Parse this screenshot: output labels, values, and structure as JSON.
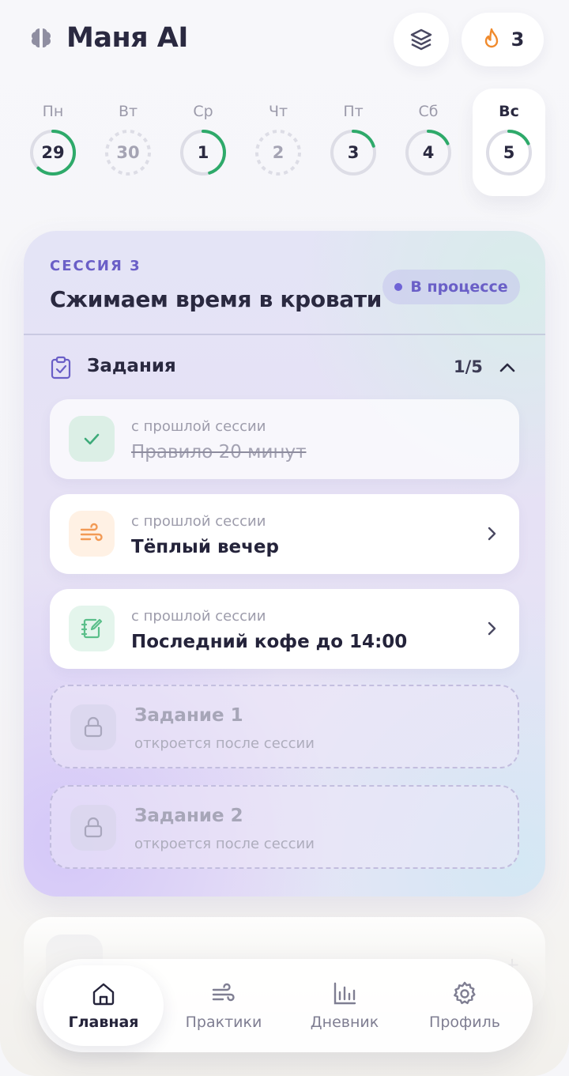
{
  "app": {
    "name": "Маня AI"
  },
  "header": {
    "streak_count": "3"
  },
  "week": [
    {
      "name": "Пн",
      "num": "29",
      "progress": 0.62,
      "state": "ring"
    },
    {
      "name": "Вт",
      "num": "30",
      "progress": 0,
      "state": "dashed"
    },
    {
      "name": "Ср",
      "num": "1",
      "progress": 0.45,
      "state": "ring"
    },
    {
      "name": "Чт",
      "num": "2",
      "progress": 0,
      "state": "dashed"
    },
    {
      "name": "Пт",
      "num": "3",
      "progress": 0.2,
      "state": "ring"
    },
    {
      "name": "Сб",
      "num": "4",
      "progress": 0.18,
      "state": "ring"
    },
    {
      "name": "Вс",
      "num": "5",
      "progress": 0.18,
      "state": "ring",
      "active": true
    }
  ],
  "session": {
    "label": "СЕССИЯ 3",
    "title": "Сжимаем время в кровати",
    "status": "В процессе",
    "tasks_title": "Задания",
    "tasks_count": "1/5",
    "tasks": [
      {
        "sub": "с прошлой сессии",
        "title": "Правило 20 минут",
        "done": true,
        "icon": "check-icon"
      },
      {
        "sub": "с прошлой сессии",
        "title": "Тёплый вечер",
        "done": false,
        "icon": "wind-icon"
      },
      {
        "sub": "с прошлой сессии",
        "title": "Последний кофе до 14:00",
        "done": false,
        "icon": "notebook-pen-icon"
      }
    ],
    "locked": [
      {
        "title": "Задание 1",
        "sub": "откроется после сессии"
      },
      {
        "title": "Задание 2",
        "sub": "откроется после сессии"
      }
    ]
  },
  "peek": {
    "plus": "+"
  },
  "nav": {
    "home": "Главная",
    "practices": "Практики",
    "diary": "Дневник",
    "profile": "Профиль"
  },
  "colors": {
    "accent": "#6a5fc7",
    "ring_green": "#2eaa6a",
    "streak_orange": "#f08a2c",
    "text_dark": "#24233a"
  }
}
